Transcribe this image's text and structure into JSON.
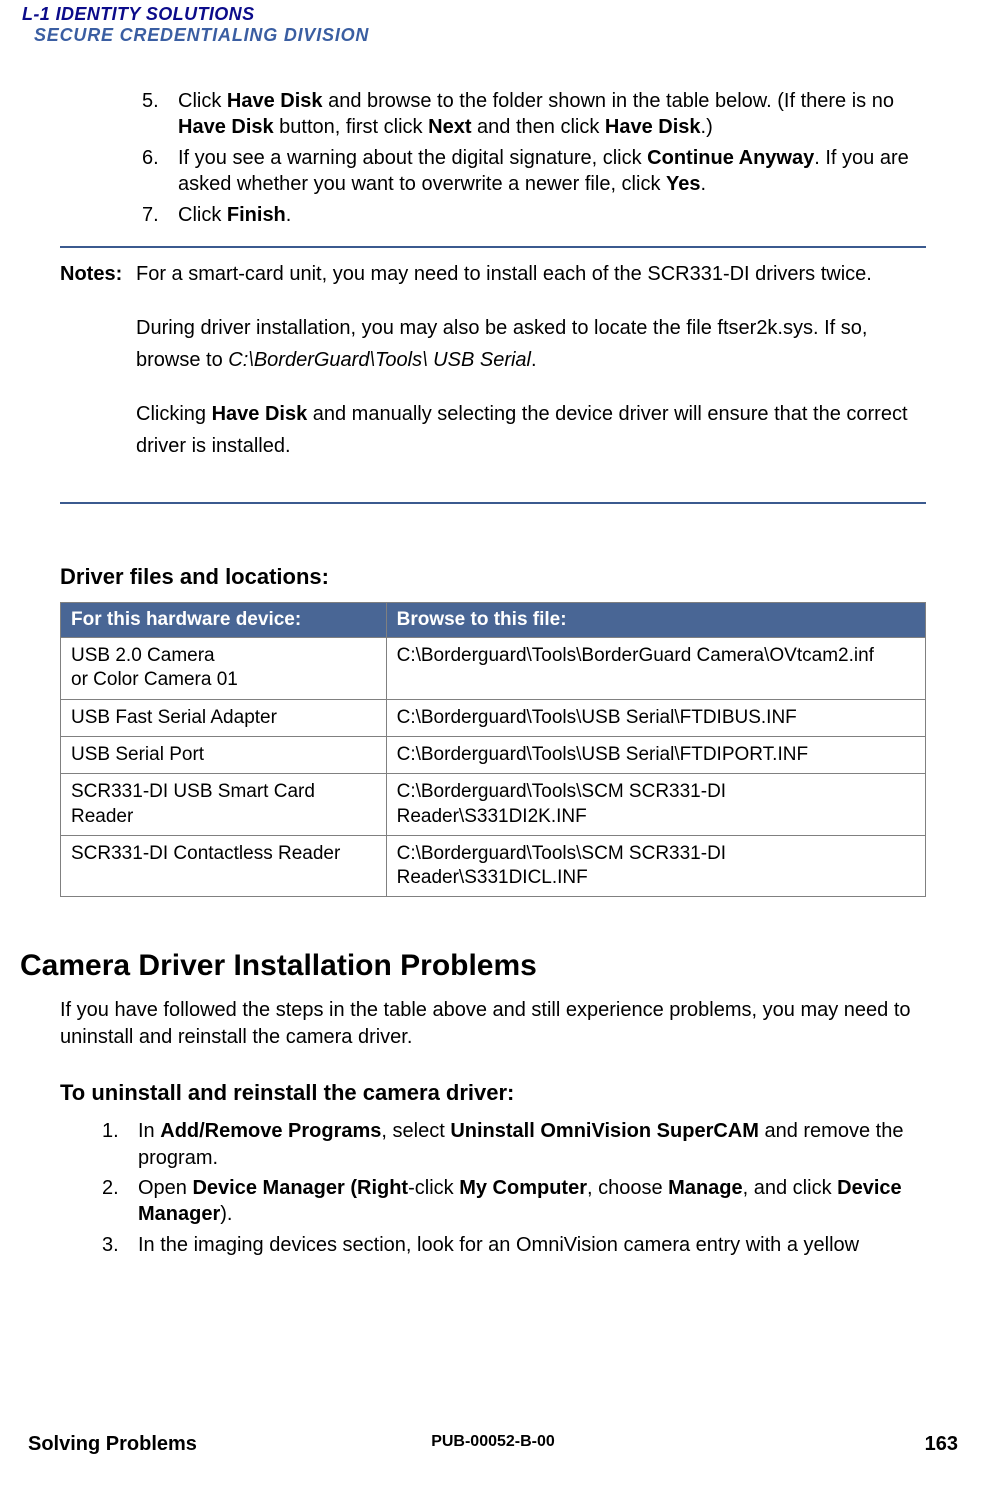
{
  "logo": {
    "line1": "L-1 IDENTITY SOLUTIONS",
    "line2": "SECURE CREDENTIALING DIVISION"
  },
  "steps_a": [
    {
      "n": "5.",
      "html": "Click <b>Have Disk</b> and browse to the folder shown in the table below. (If there is no <b>Have Disk</b> button, first click <b>Next</b> and then click <b>Have Disk</b>.)"
    },
    {
      "n": "6.",
      "html": "If you see a warning about the digital signature, click <b>Continue Anyway</b>. If you are asked whether you want to overwrite a newer file, click <b>Yes</b>."
    },
    {
      "n": "7.",
      "html": "Click <b>Finish</b>."
    }
  ],
  "notes": {
    "label": "Notes:",
    "paras": [
      "For a smart-card unit, you may need to install each of the SCR331-DI drivers twice.",
      "During driver installation, you may also be asked to locate the file ftser2k.sys. If so, browse to <span class=\"ital\">C:\\BorderGuard\\Tools\\ USB Serial</span>.",
      "Clicking <b>Have Disk</b> and manually selecting the device driver will ensure that the correct driver is installed."
    ]
  },
  "table": {
    "title": "Driver files and locations:",
    "head": [
      "For this hardware device:",
      "Browse to this file:"
    ],
    "rows": [
      [
        "USB 2.0 Camera<br>or Color  Camera  01",
        "C:\\Borderguard\\Tools\\BorderGuard Camera\\OVtcam2.inf"
      ],
      [
        "USB Fast Serial Adapter",
        "C:\\Borderguard\\Tools\\USB Serial\\FTDIBUS.INF"
      ],
      [
        "USB Serial Port",
        "C:\\Borderguard\\Tools\\USB Serial\\FTDIPORT.INF"
      ],
      [
        "SCR331-DI USB Smart Card Reader",
        "C:\\Borderguard\\Tools\\SCM SCR331-DI Reader\\S331DI2K.INF"
      ],
      [
        "SCR331-DI Contactless Reader",
        "C:\\Borderguard\\Tools\\SCM SCR331-DI Reader\\S331DICL.INF"
      ]
    ]
  },
  "section2": {
    "heading": "Camera Driver Installation Problems",
    "intro": "If you have followed the steps in the table above and still experience problems, you may need to uninstall and reinstall the camera driver.",
    "sub": "To uninstall and reinstall the camera driver:",
    "steps": [
      {
        "n": "1.",
        "html": "In <b>Add/Remove Programs</b>, select <b>Uninstall OmniVision SuperCAM</b> and remove the program."
      },
      {
        "n": "2.",
        "html": "Open <b>Device Manager (Right</b>-click <b>My Computer</b>, choose <b>Manage</b>, and click <b>Device Manager</b>)."
      },
      {
        "n": "3.",
        "html": "In the imaging devices section, look for an OmniVision camera entry with a yellow"
      }
    ]
  },
  "footer": {
    "left": "Solving Problems",
    "center": "PUB-00052-B-00",
    "right": "163"
  }
}
